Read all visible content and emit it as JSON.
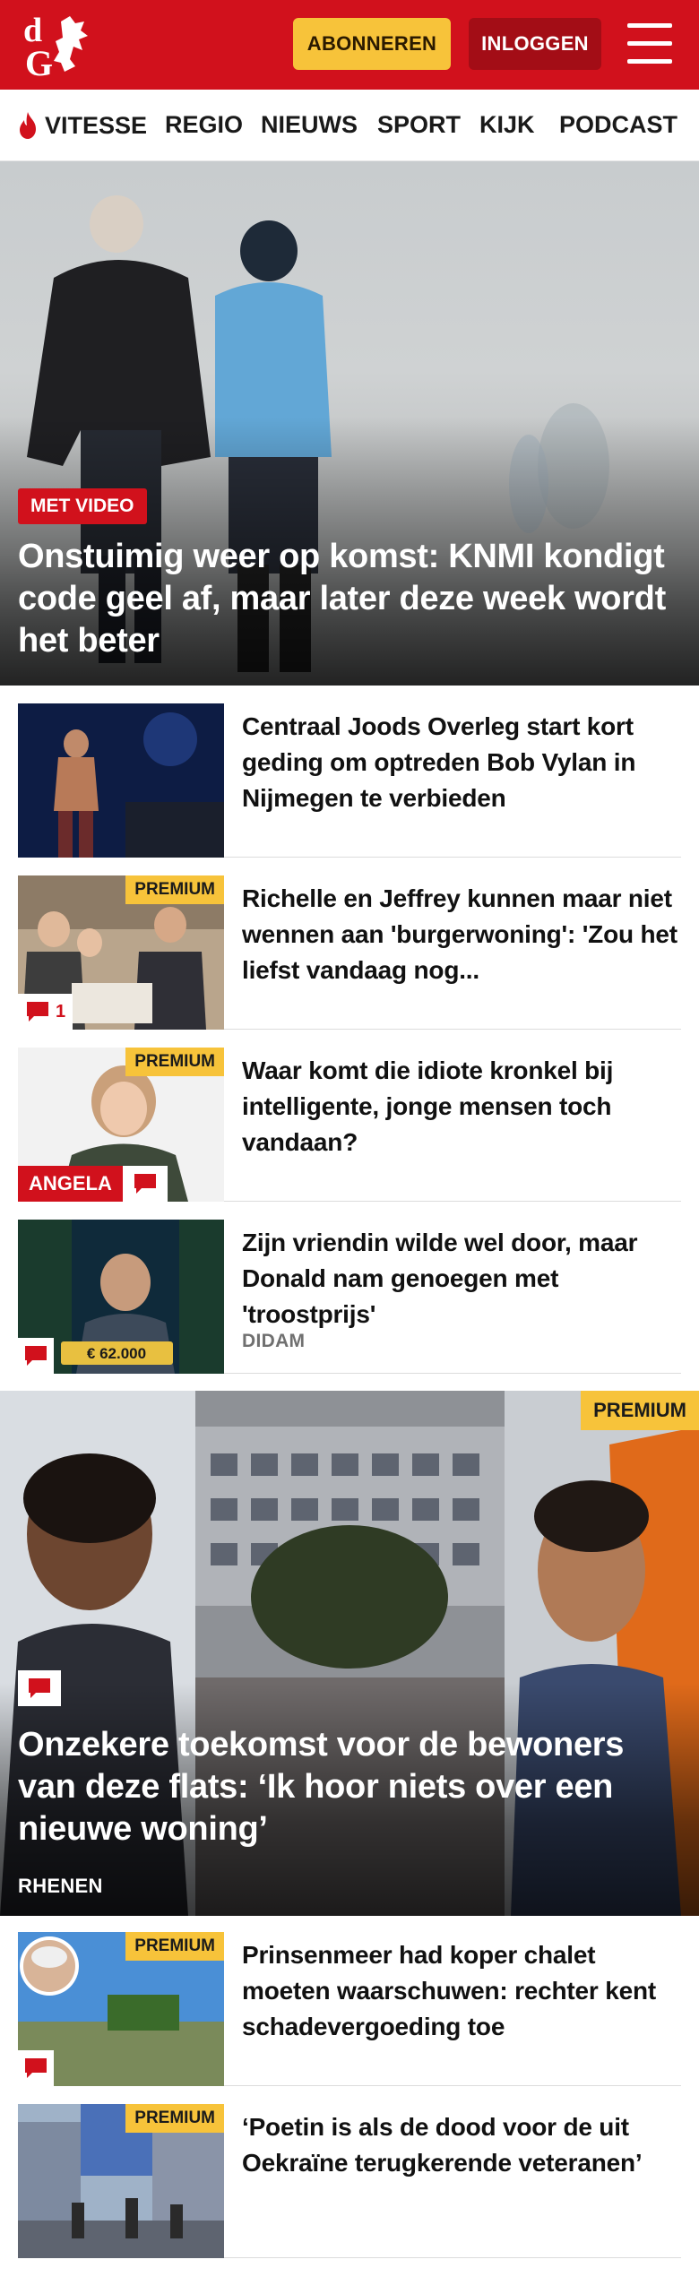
{
  "header": {
    "logo_text": "dG",
    "subscribe_label": "ABONNEREN",
    "login_label": "INLOGGEN",
    "menu_icon": "hamburger-menu-icon",
    "brand_color": "#d1111c",
    "accent_color": "#f7c33a"
  },
  "nav": {
    "items": [
      {
        "label": "VITESSE",
        "icon": "flame-icon"
      },
      {
        "label": "REGIO"
      },
      {
        "label": "NIEUWS"
      },
      {
        "label": "SPORT"
      },
      {
        "label": "KIJK"
      },
      {
        "label": "PODCAST"
      }
    ]
  },
  "hero": {
    "badge": "MET VIDEO",
    "title": "Onstuimig weer op komst: KNMI kondigt code geel af, maar later deze week wordt het beter"
  },
  "articles": [
    {
      "title": "Centraal Joods Overleg start kort geding om optreden Bob Vylan in Nijmegen te verbieden"
    },
    {
      "title": "Richelle en Jeffrey kunnen maar niet wennen aan 'burgerwoning': 'Zou het liefst vandaag nog...",
      "premium": "PREMIUM",
      "comments": "1"
    },
    {
      "title": "Waar komt die idiote kronkel bij intelligente, jonge mensen toch vandaan?",
      "premium": "PREMIUM",
      "author": "ANGELA"
    },
    {
      "title": "Zijn vriendin wilde wel door, maar Donald nam genoegen met 'troostprijs'",
      "city": "DIDAM",
      "prize": "€ 62.000"
    }
  ],
  "feature": {
    "premium": "PREMIUM",
    "title": "Onzekere toekomst voor de bewoners van deze flats: ‘Ik hoor niets over een nieuwe woning’",
    "city": "RHENEN"
  },
  "articles2": [
    {
      "title": "Prinsenmeer had koper chalet moeten waarschuwen: rechter kent schadevergoeding toe",
      "premium": "PREMIUM"
    },
    {
      "title": "‘Poetin is als de dood voor de uit Oekraïne terugkerende veteranen’",
      "premium": "PREMIUM"
    }
  ]
}
